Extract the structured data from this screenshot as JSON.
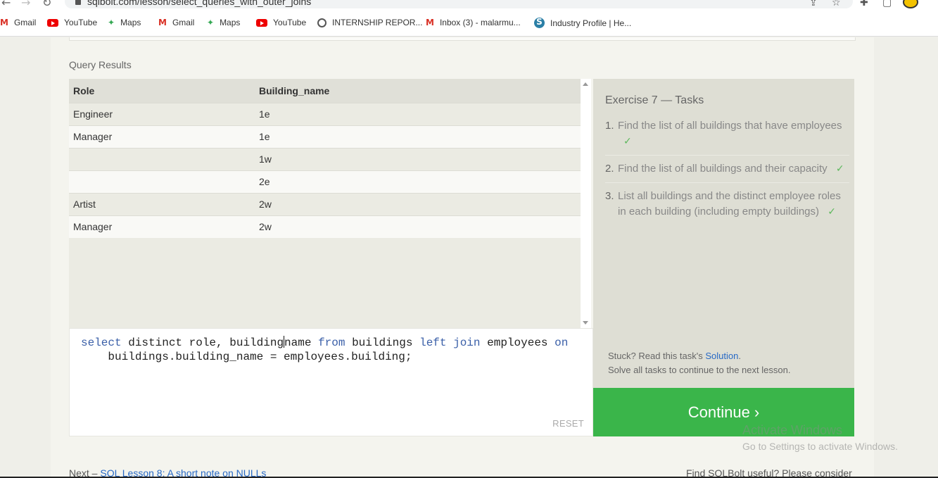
{
  "browser": {
    "url": "sqlbolt.com/lesson/select_queries_with_outer_joins",
    "bookmarks": [
      {
        "label": "Gmail",
        "icon": "gmail-icon"
      },
      {
        "label": "YouTube",
        "icon": "youtube-icon"
      },
      {
        "label": "Maps",
        "icon": "maps-icon"
      },
      {
        "label": "Gmail",
        "icon": "gmail-icon"
      },
      {
        "label": "Maps",
        "icon": "maps-icon"
      },
      {
        "label": "YouTube",
        "icon": "youtube-icon"
      },
      {
        "label": "INTERNSHIP REPOR...",
        "icon": "globe-icon"
      },
      {
        "label": "Inbox (3) - malarmu...",
        "icon": "gmail-icon"
      },
      {
        "label": "Industry Profile | He...",
        "icon": "industry-icon"
      }
    ]
  },
  "results": {
    "title": "Query Results",
    "headers": [
      "Role",
      "Building_name"
    ],
    "rows": [
      [
        "Engineer",
        "1e"
      ],
      [
        "Manager",
        "1e"
      ],
      [
        "",
        "1w"
      ],
      [
        "",
        "2e"
      ],
      [
        "Artist",
        "2w"
      ],
      [
        "Manager",
        "2w"
      ]
    ]
  },
  "editor": {
    "reset_label": "RESET"
  },
  "tasks": {
    "title": "Exercise 7 — Tasks",
    "items": [
      {
        "num": "1.",
        "text": "Find the list of all buildings that have employees",
        "done": "✓"
      },
      {
        "num": "2.",
        "text": "Find the list of all buildings and their capacity",
        "done": "✓"
      },
      {
        "num": "3.",
        "text": "List all buildings and the distinct employee roles in each building (including empty buildings)",
        "done": "✓"
      }
    ],
    "stuck_text": "Stuck? Read this task's ",
    "solution_link": "Solution",
    "stuck_end": ".",
    "solve_text": "Solve all tasks to continue to the next lesson."
  },
  "continue_label": "Continue ›",
  "watermark": {
    "line1": "Activate Windows",
    "line2": "Go to Settings to activate Windows."
  },
  "footer": {
    "next_prefix": "Next – ",
    "next_link": "SQL Lesson 8: A short note on NULLs",
    "right_text": "Find SQLBolt useful? Please consider"
  },
  "colors": {
    "continue_bg": "#3ab54a",
    "link": "#2769c5",
    "keyword": "#3a5fa8",
    "check": "#5cb85c"
  }
}
